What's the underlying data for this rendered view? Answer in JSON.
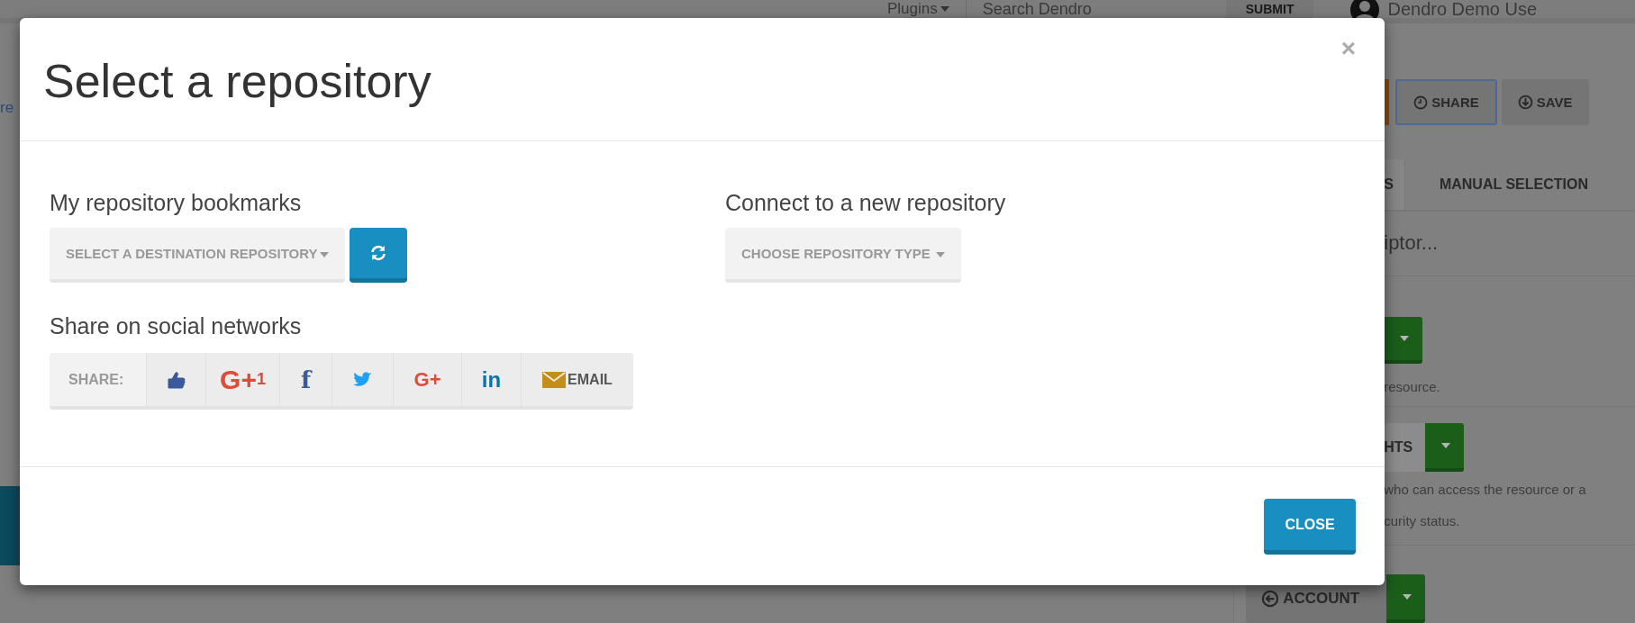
{
  "background": {
    "left_link": "re",
    "top_bar": {
      "plugins": "Plugins",
      "search_placeholder": "Search Dendro",
      "submit": "SUBMIT",
      "user": "Dendro Demo Use"
    },
    "actions": [
      {
        "label": "SHARE",
        "kind": "share"
      },
      {
        "label": "SAVE",
        "kind": "save"
      }
    ],
    "tabs": [
      {
        "label": "S",
        "selected": true
      },
      {
        "label": "MANUAL SELECTION",
        "selected": false
      }
    ],
    "descriptor_placeholder": "iptor...",
    "note_1": "resource.",
    "rights_button": "HTS",
    "note_2": [
      "who can access the resource or a",
      "curity status."
    ],
    "account_button": "ACCOUNT"
  },
  "modal": {
    "title": "Select a repository",
    "close_icon": "×",
    "bookmarks": {
      "label": "My repository bookmarks",
      "dropdown": "SELECT A DESTINATION REPOSITORY"
    },
    "connect": {
      "label": "Connect to a new repository",
      "dropdown": "CHOOSE REPOSITORY TYPE"
    },
    "share": {
      "heading": "Share on social networks",
      "label": "SHARE:",
      "items": [
        {
          "kind": "like",
          "color": "#3b5998"
        },
        {
          "kind": "plusone",
          "text": "G+",
          "count": "1",
          "color": "#dd4b39"
        },
        {
          "kind": "facebook",
          "text": "f",
          "color": "#3b5998"
        },
        {
          "kind": "twitter",
          "color": "#1da1f2"
        },
        {
          "kind": "gplus",
          "text": "G+",
          "color": "#dd4b39"
        },
        {
          "kind": "linkedin",
          "text": "in",
          "color": "#0077b5"
        },
        {
          "kind": "email",
          "text": "EMAIL",
          "color": "#c28f1b"
        }
      ]
    },
    "footer_button": "CLOSE"
  }
}
